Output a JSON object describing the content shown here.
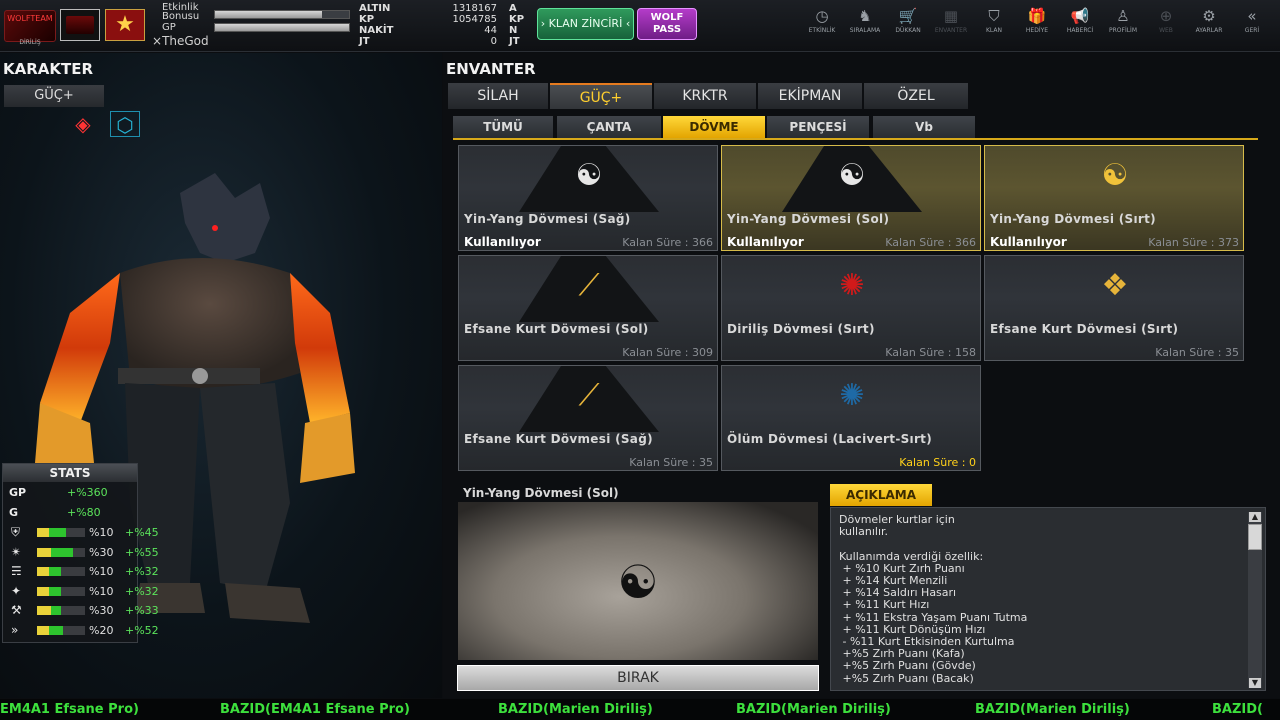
{
  "topbar": {
    "logo_text": "WOLFTEAM",
    "logo_sub": "DİRİLİŞ",
    "bonus_label_1": "Etkinlik",
    "bonus_label_2": "Bonusu",
    "gp_label": "GP",
    "bonus_fill": 0.8,
    "gp_fill": 1.0,
    "username": "TheGod",
    "currencies": [
      {
        "key": "ALTIN",
        "value": "1318167",
        "unit": "A"
      },
      {
        "key": "KP",
        "value": "1054785",
        "unit": "KP"
      },
      {
        "key": "NAKİT",
        "value": "44",
        "unit": "N"
      },
      {
        "key": "JT",
        "value": "0",
        "unit": "JT"
      }
    ],
    "klan_button": "KLAN ZİNCİRİ",
    "wolf_pass_1": "WOLF",
    "wolf_pass_2": "PASS",
    "nav": [
      {
        "label": "ETKİNLİK",
        "icon": "clock-icon",
        "glyph": "◷",
        "dim": false
      },
      {
        "label": "SIRALAMA",
        "icon": "wolf-head-icon",
        "glyph": "♞",
        "dim": false
      },
      {
        "label": "DÜKKAN",
        "icon": "cart-icon",
        "glyph": "🛒",
        "dim": false
      },
      {
        "label": "ENVANTER",
        "icon": "inventory-icon",
        "glyph": "▦",
        "dim": true
      },
      {
        "label": "KLAN",
        "icon": "shield-icon",
        "glyph": "⛉",
        "dim": false
      },
      {
        "label": "HEDİYE",
        "icon": "gift-icon",
        "glyph": "🎁",
        "dim": false
      },
      {
        "label": "HABERCİ",
        "icon": "megaphone-icon",
        "glyph": "📢",
        "dim": false
      },
      {
        "label": "PROFİLİM",
        "icon": "profile-icon",
        "glyph": "♙",
        "dim": false
      },
      {
        "label": "WEB",
        "icon": "web-icon",
        "glyph": "⊕",
        "dim": true
      },
      {
        "label": "AYARLAR",
        "icon": "gear-icon",
        "glyph": "⚙",
        "dim": false
      },
      {
        "label": "GERİ",
        "icon": "back-icon",
        "glyph": "«",
        "dim": false
      }
    ]
  },
  "left": {
    "title": "KARAKTER",
    "tab": "GÜÇ+",
    "stats_title": "STATS",
    "stats": [
      {
        "key": "GP",
        "value": "+%360"
      },
      {
        "key": "G",
        "value": "+%80"
      }
    ],
    "stat_bars": [
      {
        "icon": "armor-icon",
        "glyph": "⛨",
        "base": "%10",
        "bonus": "+%45",
        "yellow": 0.25,
        "green": 0.6
      },
      {
        "icon": "jump-icon",
        "glyph": "✴",
        "base": "%30",
        "bonus": "+%55",
        "yellow": 0.3,
        "green": 0.75
      },
      {
        "icon": "speed-icon",
        "glyph": "☴",
        "base": "%10",
        "bonus": "+%32",
        "yellow": 0.25,
        "green": 0.5
      },
      {
        "icon": "attack-icon",
        "glyph": "✦",
        "base": "%10",
        "bonus": "+%32",
        "yellow": 0.25,
        "green": 0.5
      },
      {
        "icon": "range-icon",
        "glyph": "⚒",
        "base": "%30",
        "bonus": "+%33",
        "yellow": 0.3,
        "green": 0.5
      },
      {
        "icon": "dash-icon",
        "glyph": "»",
        "base": "%20",
        "bonus": "+%52",
        "yellow": 0.25,
        "green": 0.55
      }
    ]
  },
  "right": {
    "title": "ENVANTER",
    "main_tabs": [
      "SİLAH",
      "GÜÇ+",
      "KRKTR",
      "EKİPMAN",
      "ÖZEL"
    ],
    "sub_tabs": [
      "TÜMÜ",
      "ÇANTA",
      "DÖVME",
      "PENÇESİ",
      "Vb"
    ],
    "cards": [
      {
        "name": "Yin-Yang Dövmesi (Sağ)",
        "status": "Kullanılıyor",
        "time": "Kalan Süre : 366",
        "glyph": "☯",
        "color": "#e6e6e6",
        "selected": false,
        "shape": true
      },
      {
        "name": "Yin-Yang Dövmesi (Sol)",
        "status": "Kullanılıyor",
        "time": "Kalan Süre : 366",
        "glyph": "☯",
        "color": "#e6e6e6",
        "selected": true,
        "shape": true
      },
      {
        "name": "Yin-Yang Dövmesi (Sırt)",
        "status": "Kullanılıyor",
        "time": "Kalan Süre : 373",
        "glyph": "☯",
        "color": "#f0c23a",
        "selected": true,
        "shape": false
      },
      {
        "name": "Efsane Kurt Dövmesi (Sol)",
        "status": "",
        "time": "Kalan Süre : 309",
        "glyph": "⟋",
        "color": "#e6b43a",
        "selected": false,
        "shape": true
      },
      {
        "name": "Diriliş Dövmesi (Sırt)",
        "status": "",
        "time": "Kalan Süre : 158",
        "glyph": "✺",
        "color": "#d21a1a",
        "selected": false,
        "shape": false
      },
      {
        "name": "Efsane Kurt Dövmesi (Sırt)",
        "status": "",
        "time": "Kalan Süre : 35",
        "glyph": "❖",
        "color": "#e6b43a",
        "selected": false,
        "shape": false
      },
      {
        "name": "Efsane Kurt Dövmesi (Sağ)",
        "status": "",
        "time": "Kalan Süre : 35",
        "glyph": "⟋",
        "color": "#e6b43a",
        "selected": false,
        "shape": true
      },
      {
        "name": "Ölüm Dövmesi (Lacivert-Sırt)",
        "status": "",
        "time": "Kalan Süre : 0",
        "glyph": "✺",
        "color": "#1e6aa6",
        "selected": false,
        "shape": false,
        "zero": true
      }
    ],
    "detail_title": "Yin-Yang Dövmesi (Sol)",
    "drop_button": "BIRAK",
    "desc_tab": "AÇIKLAMA",
    "desc_text": "Dövmeler kurtlar için\nkullanılır.\n\nKullanımda verdiği özellik:\n + %10 Kurt Zırh Puanı\n + %14 Kurt Menzili\n + %14 Saldırı Hasarı\n + %11 Kurt Hızı\n + %11 Ekstra Yaşam Puanı Tutma\n + %11 Kurt Dönüşüm Hızı\n - %11 Kurt Etkisinden Kurtulma\n +%5 Zırh Puanı (Kafa)\n +%5 Zırh Puanı (Gövde)\n +%5 Zırh Puanı (Bacak)"
  },
  "ticker": [
    "EM4A1 Efsane Pro)",
    "BAZID(EM4A1 Efsane Pro)",
    "BAZID(Marien Diriliş)",
    "BAZID(Marien Diriliş)",
    "BAZID(Marien Diriliş)",
    "BAZID("
  ]
}
